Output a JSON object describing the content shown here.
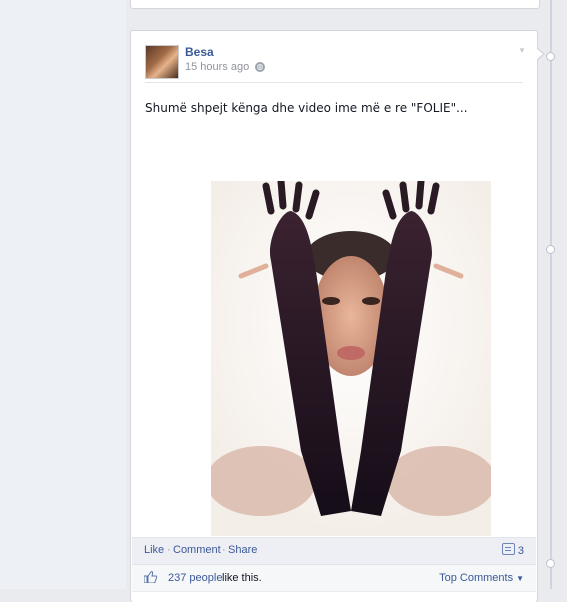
{
  "post": {
    "author": "Besa",
    "time": "15 hours ago",
    "message": "Shumë shpejt kënga dhe video ime më e re \"FOLIE\"..."
  },
  "actions": {
    "like": "Like",
    "comment": "Comment",
    "share": "Share",
    "separator": "·",
    "comment_count": "3"
  },
  "likes": {
    "count_text": "237 people",
    "suffix": "like this.",
    "top_comments": "Top Comments"
  },
  "icons": {
    "globe": "globe-icon",
    "thumb": "like-thumb-icon",
    "comment": "comment-icon",
    "chevron": "chevron-down-icon"
  },
  "colors": {
    "link": "#3b5998",
    "muted": "#90949c",
    "background": "#e9ebee"
  }
}
